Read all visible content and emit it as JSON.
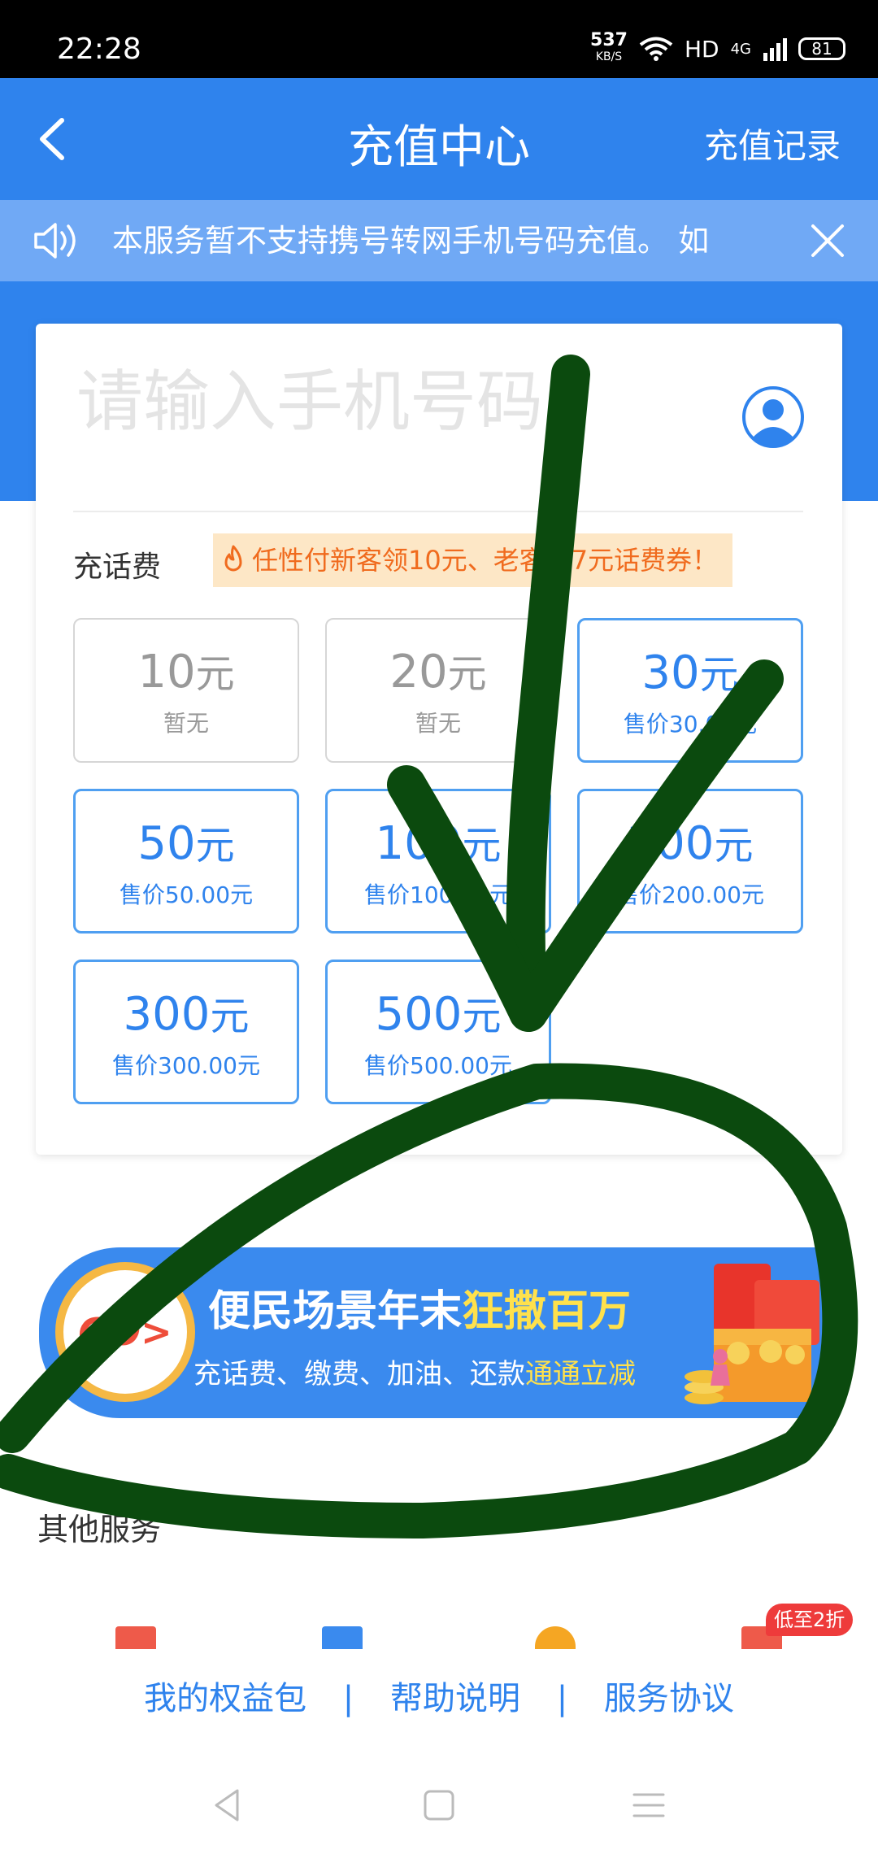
{
  "status_bar": {
    "time": "22:28",
    "net_speed_value": "537",
    "net_speed_unit": "KB/S",
    "hd": "HD",
    "network": "4G",
    "battery": "81"
  },
  "header": {
    "title": "充值中心",
    "action_label": "充值记录"
  },
  "notice": {
    "text": "本服务暂不支持携号转网手机号码充值。 如"
  },
  "card": {
    "phone_placeholder": "请输入手机号码",
    "section_label": "充话费",
    "promo_text": "任性付新客领10元、老客领7元话费券！",
    "tiles": [
      {
        "amount": "10",
        "unit": "元",
        "price": "暂无",
        "available": false
      },
      {
        "amount": "20",
        "unit": "元",
        "price": "暂无",
        "available": false
      },
      {
        "amount": "30",
        "unit": "元",
        "price": "售价30.00元",
        "available": true
      },
      {
        "amount": "50",
        "unit": "元",
        "price": "售价50.00元",
        "available": true
      },
      {
        "amount": "100",
        "unit": "元",
        "price": "售价100.00元",
        "available": true
      },
      {
        "amount": "200",
        "unit": "元",
        "price": "售价200.00元",
        "available": true
      },
      {
        "amount": "300",
        "unit": "元",
        "price": "售价300.00元",
        "available": true
      },
      {
        "amount": "500",
        "unit": "元",
        "price": "售价500.00元",
        "available": true
      }
    ]
  },
  "banner": {
    "go_label": "GO>",
    "title_main": "便民场景年末",
    "title_highlight": "狂撒百万",
    "subtitle_main": "充话费、缴费、加油、还款",
    "subtitle_highlight": "通通立减"
  },
  "other_services": {
    "title": "其他服务",
    "badge": "低至2折"
  },
  "footer": {
    "link1": "我的权益包",
    "link2": "帮助说明",
    "link3": "服务协议",
    "separator": "|"
  },
  "colors": {
    "primary": "#2f83ed",
    "notice_bg": "#70a9f5",
    "promo_bg": "#fde7c6",
    "promo_text": "#f06b1e",
    "annotation": "#0b4a0e"
  }
}
